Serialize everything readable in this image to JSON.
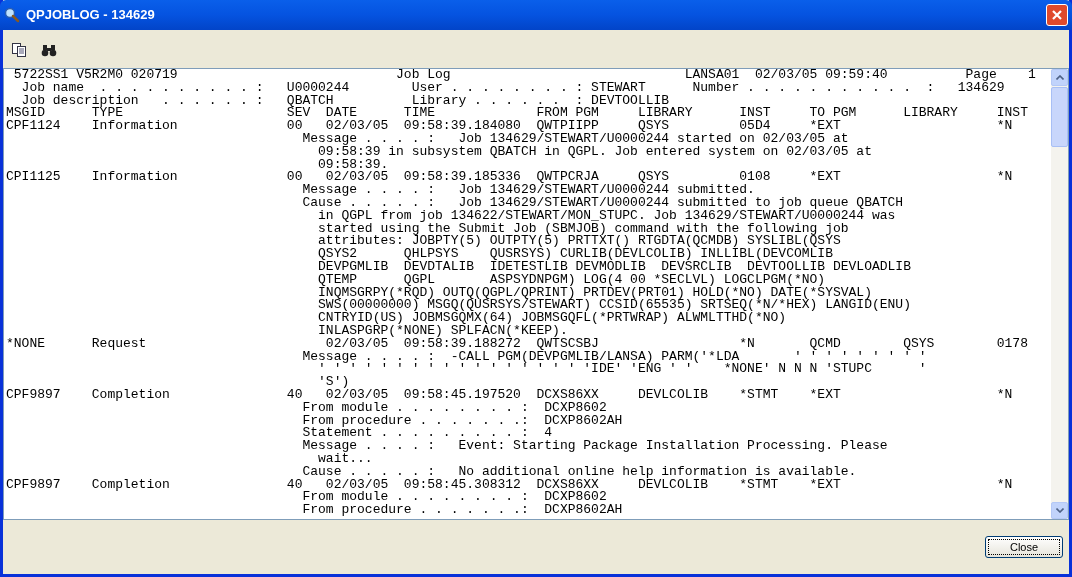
{
  "window": {
    "title": "QPJOBLOG - 134629"
  },
  "report": {
    "lines": [
      " 5722SS1 V5R2M0 020719                            Job Log                              LANSA01  02/03/05 09:59:40          Page    1",
      "  Job name  . . . . . . . . . . :   U0000244        User . . . . . . . . : STEWART      Number . . . . . . . . . . .  :   134629",
      "  Job description   . . . . . . :   QBATCH          Library . . . . . .  : DEVTOOLLIB",
      "MSGID      TYPE                     SEV  DATE      TIME             FROM PGM     LIBRARY      INST     TO PGM      LIBRARY     INST",
      "CPF1124    Information              00   02/03/05  09:58:39.184080  QWTPIIPP     QSYS         05D4     *EXT                    *N",
      "                                      Message . . . . :   Job 134629/STEWART/U0000244 started on 02/03/05 at",
      "                                        09:58:39 in subsystem QBATCH in QGPL. Job entered system on 02/03/05 at",
      "                                        09:58:39.",
      "CPI1125    Information              00   02/03/05  09:58:39.185336  QWTPCRJA     QSYS         0108     *EXT                    *N",
      "                                      Message . . . . :   Job 134629/STEWART/U0000244 submitted.",
      "                                      Cause . . . . . :   Job 134629/STEWART/U0000244 submitted to job queue QBATCH",
      "                                        in QGPL from job 134622/STEWART/MON_STUPC. Job 134629/STEWART/U0000244 was",
      "                                        started using the Submit Job (SBMJOB) command with the following job",
      "                                        attributes: JOBPTY(5) OUTPTY(5) PRTTXT() RTGDTA(QCMDB) SYSLIBL(QSYS",
      "                                        QSYS2      QHLPSYS    QUSRSYS) CURLIB(DEVLCOLIB) INLLIBL(DEVCOMLIB",
      "                                        DEVPGMLIB  DEVDTALIB  IDETESTLIB DEVMODLIB  DEVSRCLIB  DEVTOOLLIB DEVLOADLIB",
      "                                        QTEMP      QGPL       ASPSYDNPGM) LOG(4 00 *SECLVL) LOGCLPGM(*NO)",
      "                                        INQMSGRPY(*RQD) OUTQ(QGPL/QPRINT) PRTDEV(PRT01) HOLD(*NO) DATE(*SYSVAL)",
      "                                        SWS(00000000) MSGQ(QUSRSYS/STEWART) CCSID(65535) SRTSEQ(*N/*HEX) LANGID(ENU)",
      "                                        CNTRYID(US) JOBMSGQMX(64) JOBMSGQFL(*PRTWRAP) ALWMLTTHD(*NO)",
      "                                        INLASPGRP(*NONE) SPLFACN(*KEEP).",
      "*NONE      Request                       02/03/05  09:58:39.188272  QWTSCSBJ                  *N       QCMD        QSYS        0178",
      "                                      Message . . . . :  -CALL PGM(DEVPGMLIB/LANSA) PARM('*LDA       ' ' ' ' ' ' ' ' '",
      "                                        ' ' ' ' ' ' ' ' ' ' ' ' ' ' ' ' ' 'IDE' 'ENG ' '    *NONE' N N N 'STUPC      '",
      "                                        'S')",
      "CPF9897    Completion               40   02/03/05  09:58:45.197520  DCXS86XX     DEVLCOLIB    *STMT    *EXT                    *N",
      "                                      From module . . . . . . . . :  DCXP8602",
      "                                      From procedure . . . . . . .:  DCXP8602AH",
      "                                      Statement . . . . . . . . . :  4",
      "                                      Message . . . . :   Event: Starting Package Installation Processing. Please",
      "                                        wait...",
      "                                      Cause . . . . . :   No additional online help information is available.",
      "CPF9897    Completion               40   02/03/05  09:58:45.308312  DCXS86XX     DEVLCOLIB    *STMT    *EXT                    *N",
      "                                      From module . . . . . . . . :  DCXP8602",
      "                                      From procedure . . . . . . .:  DCXP8602AH"
    ]
  },
  "buttons": [
    {
      "label": "Close"
    }
  ]
}
